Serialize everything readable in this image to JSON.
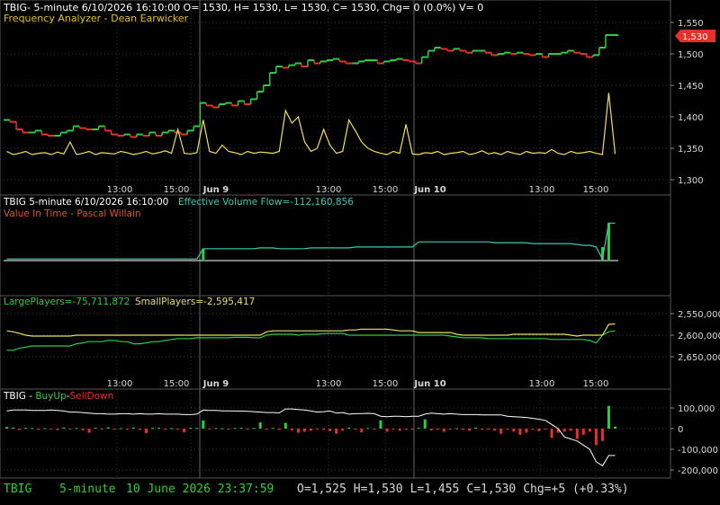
{
  "colors": {
    "background": "#000000",
    "grid": "#3a3a3a",
    "axis_text": "#d8d8d8",
    "up": "#2ecc40",
    "down": "#e8302a",
    "volume": "#f0e060",
    "evf": "#40c8b0",
    "vit": "#e05030",
    "large_players": "#2ecc40",
    "small_players": "#e8e060",
    "buy_sell_line": "#ffffff",
    "last_price_badge": "#e8302a",
    "footer_green": "#30d030"
  },
  "time_axis": {
    "labels": [
      "13:00",
      "15:00",
      "Jun 9",
      "13:00",
      "15:00",
      "Jun 10",
      "13:00",
      "15:00"
    ],
    "bold": [
      false,
      false,
      true,
      false,
      false,
      true,
      false,
      false
    ]
  },
  "panel1": {
    "header": "TBIG- 5-minute 6/10/2026 16:10:00 O= 1530, H= 1530, L= 1530, C= 1530, Chg= 0 (0.0%) V= 0",
    "subtitle": "Frequency Analyzer - Dean Earwicker",
    "y_ticks": [
      "1,550",
      "1,500",
      "1,450",
      "1,400",
      "1,350",
      "1,300"
    ],
    "last_price": "1,530"
  },
  "panel2": {
    "header_prefix": "TBIG 5-minute  6/10/2026 16:10:00",
    "header_evf": "Effective Volume Flow=-112,160,856",
    "subtitle": "Value In Time - Pascal Willain"
  },
  "panel3": {
    "label_large": "LargePlayers=-75,711,872",
    "label_small": "SmallPlayers=-2,595,417",
    "y_ticks": [
      "2,550,000",
      "2,600,000",
      "2,650,000"
    ]
  },
  "panel4": {
    "title_prefix": "TBIG - ",
    "title_buy": "BuyUp",
    "title_sep": "-",
    "title_sell": "SellDown",
    "y_ticks": [
      "100,000",
      "0",
      "-100,000",
      "-200,000"
    ]
  },
  "footer": {
    "symbol": "TBIG",
    "interval": "5-minute",
    "datetime": "10 June 2026 23:37:59",
    "open": "O=1,525",
    "high": "H=1,530",
    "low": "L=1,455",
    "close": "C=1,530",
    "change": "Chg=+5 (+0.33%)"
  },
  "chart_data": [
    {
      "type": "line",
      "title": "TBIG 5-minute price",
      "ylim": [
        1300,
        1560
      ],
      "series": [
        {
          "values": [
            1395,
            1392,
            1380,
            1375,
            1375,
            1378,
            1372,
            1370,
            1370,
            1375,
            1378,
            1385,
            1382,
            1380,
            1380,
            1385,
            1378,
            1372,
            1370,
            1372,
            1368,
            1372,
            1370,
            1375,
            1370,
            1375,
            1378,
            1375,
            1372,
            1378,
            1385,
            1422,
            1418,
            1415,
            1420,
            1422,
            1418,
            1425,
            1420,
            1428,
            1440,
            1450,
            1470,
            1480,
            1478,
            1482,
            1485,
            1480,
            1490,
            1485,
            1488,
            1490,
            1492,
            1488,
            1485,
            1485,
            1488,
            1490,
            1490,
            1485,
            1488,
            1490,
            1492,
            1490,
            1488,
            1485,
            1495,
            1505,
            1510,
            1508,
            1505,
            1508,
            1505,
            1502,
            1505,
            1505,
            1502,
            1498,
            1500,
            1502,
            1500,
            1502,
            1500,
            1498,
            1500,
            1495,
            1500,
            1500,
            1502,
            1505,
            1502,
            1500,
            1495,
            1498,
            1510,
            1530,
            1530
          ]
        }
      ]
    },
    {
      "type": "line",
      "title": "Frequency Analyzer - Dean Earwicker",
      "series": [
        {
          "values": [
            1345,
            1340,
            1342,
            1345,
            1340,
            1342,
            1343,
            1340,
            1344,
            1341,
            1360,
            1340,
            1342,
            1345,
            1340,
            1343,
            1342,
            1341,
            1345,
            1343,
            1340,
            1342,
            1345,
            1341,
            1343,
            1346,
            1342,
            1380,
            1342,
            1341,
            1343,
            1395,
            1345,
            1342,
            1355,
            1345,
            1343,
            1340,
            1345,
            1342,
            1344,
            1343,
            1342,
            1345,
            1410,
            1390,
            1400,
            1360,
            1345,
            1350,
            1380,
            1355,
            1342,
            1345,
            1395,
            1378,
            1360,
            1350,
            1345,
            1342,
            1340,
            1345,
            1342,
            1388,
            1341,
            1340,
            1343,
            1342,
            1345,
            1340,
            1342,
            1343,
            1345,
            1340,
            1342,
            1346,
            1341,
            1343,
            1340,
            1345,
            1342,
            1340,
            1345,
            1342,
            1343,
            1342,
            1348,
            1342,
            1340,
            1345,
            1342,
            1343,
            1345,
            1342,
            1340,
            1438,
            1341
          ]
        }
      ]
    },
    {
      "type": "line",
      "title": "Effective Volume Flow=-112,160,856",
      "series": [
        {
          "values": [
            2,
            2,
            2,
            2,
            2,
            2,
            2,
            2,
            2,
            2,
            2,
            2,
            2,
            2,
            2,
            2,
            2,
            2,
            2,
            2,
            2,
            2,
            2,
            2,
            2,
            2,
            2,
            2,
            2,
            2,
            2,
            8,
            8,
            8,
            8,
            8,
            8,
            8,
            8,
            8,
            8.5,
            8.5,
            8.5,
            8,
            8,
            8,
            8,
            8,
            8.5,
            8.5,
            8.5,
            8.5,
            8.5,
            8.5,
            8.5,
            9,
            9,
            9,
            9,
            9,
            9,
            9,
            9,
            9,
            9,
            12,
            12,
            12,
            12,
            12,
            12,
            12,
            12,
            12,
            12,
            12,
            12,
            11.5,
            11.5,
            11.5,
            11.5,
            11.5,
            11.5,
            11,
            11,
            11,
            11,
            11,
            11,
            11,
            10.5,
            10,
            10,
            9,
            2,
            23,
            23
          ]
        }
      ]
    },
    {
      "type": "line",
      "title": "LargePlayers / SmallPlayers",
      "series": [
        {
          "name": "LargePlayers",
          "values": [
            2635000,
            2635000,
            2630000,
            2628000,
            2625000,
            2625000,
            2625000,
            2625000,
            2625000,
            2625000,
            2625000,
            2620000,
            2618000,
            2615000,
            2615000,
            2615000,
            2612000,
            2612000,
            2615000,
            2615000,
            2620000,
            2620000,
            2618000,
            2615000,
            2615000,
            2612000,
            2610000,
            2608000,
            2608000,
            2608000,
            2606000,
            2606000,
            2606000,
            2606000,
            2606000,
            2606000,
            2605000,
            2605000,
            2605000,
            2606000,
            2606000,
            2600000,
            2598000,
            2598000,
            2598000,
            2598000,
            2600000,
            2598000,
            2598000,
            2598000,
            2596000,
            2596000,
            2596000,
            2596000,
            2600000,
            2600000,
            2600000,
            2600000,
            2600000,
            2600000,
            2600000,
            2600000,
            2600000,
            2600000,
            2600000,
            2600000,
            2600000,
            2600000,
            2600000,
            2600000,
            2602000,
            2604000,
            2606000,
            2606000,
            2606000,
            2606000,
            2608000,
            2608000,
            2608000,
            2608000,
            2608000,
            2608000,
            2608000,
            2608000,
            2608000,
            2608000,
            2610000,
            2610000,
            2610000,
            2610000,
            2610000,
            2610000,
            2612000,
            2618000,
            2600000,
            2592000,
            2590000
          ]
        },
        {
          "name": "SmallPlayers",
          "values": [
            2590000,
            2592000,
            2596000,
            2600000,
            2602000,
            2602000,
            2602000,
            2602000,
            2602000,
            2602000,
            2602000,
            2600000,
            2600000,
            2600000,
            2600000,
            2600000,
            2600000,
            2600000,
            2600000,
            2600000,
            2600000,
            2600000,
            2600000,
            2600000,
            2600000,
            2600000,
            2600000,
            2600000,
            2600000,
            2600000,
            2600000,
            2600000,
            2600000,
            2600000,
            2600000,
            2600000,
            2600000,
            2600000,
            2600000,
            2600000,
            2600000,
            2592000,
            2590000,
            2590000,
            2590000,
            2590000,
            2590000,
            2590000,
            2590000,
            2590000,
            2590000,
            2590000,
            2590000,
            2590000,
            2588000,
            2588000,
            2586000,
            2586000,
            2586000,
            2586000,
            2586000,
            2588000,
            2590000,
            2590000,
            2590000,
            2594000,
            2594000,
            2594000,
            2594000,
            2594000,
            2594000,
            2598000,
            2600000,
            2600000,
            2600000,
            2600000,
            2600000,
            2600000,
            2600000,
            2600000,
            2598000,
            2598000,
            2598000,
            2598000,
            2598000,
            2598000,
            2598000,
            2598000,
            2598000,
            2600000,
            2602000,
            2600000,
            2600000,
            2600000,
            2600000,
            2575000,
            2574000
          ]
        }
      ]
    },
    {
      "type": "bar",
      "title": "BuyUp-SellDown",
      "ylim": [
        -220000,
        120000
      ],
      "series": [
        {
          "values": [
            8000,
            5000,
            -6000,
            4000,
            3000,
            -5000,
            2000,
            -3000,
            -7000,
            5000,
            -4000,
            3000,
            -8000,
            -20000,
            4000,
            -3000,
            6000,
            -4000,
            2000,
            -3000,
            5000,
            -6000,
            -22000,
            3000,
            4000,
            -4000,
            2000,
            -2000,
            -18000,
            4000,
            3000,
            40000,
            -3000,
            3000,
            2000,
            -2000,
            3000,
            4000,
            -2000,
            3000,
            30000,
            -2000,
            3000,
            -6000,
            28000,
            -8000,
            -20000,
            -15000,
            -10000,
            -4000,
            -5000,
            -12000,
            -25000,
            -10000,
            5000,
            -4000,
            -18000,
            3000,
            -4000,
            40000,
            -15000,
            -3000,
            -10000,
            -5000,
            -3000,
            4000,
            45000,
            -8000,
            -5000,
            -15000,
            -3000,
            2000,
            -5000,
            -10000,
            5000,
            -5000,
            -3000,
            -10000,
            -25000,
            -5000,
            -15000,
            -30000,
            -20000,
            -3000,
            -12000,
            -5000,
            -45000,
            -20000,
            -15000,
            -10000,
            -50000,
            -30000,
            -15000,
            -80000,
            -60000,
            110000,
            10000
          ]
        },
        {
          "name": "line",
          "values": [
            85000,
            90000,
            90000,
            90000,
            88000,
            88000,
            88000,
            90000,
            88000,
            85000,
            80000,
            80000,
            78000,
            75000,
            72000,
            72000,
            70000,
            70000,
            72000,
            72000,
            70000,
            72000,
            70000,
            70000,
            72000,
            70000,
            70000,
            70000,
            68000,
            68000,
            70000,
            90000,
            88000,
            88000,
            86000,
            86000,
            85000,
            85000,
            84000,
            82000,
            80000,
            78000,
            78000,
            76000,
            95000,
            95000,
            92000,
            90000,
            85000,
            80000,
            82000,
            85000,
            75000,
            78000,
            70000,
            72000,
            73000,
            74000,
            72000,
            60000,
            58000,
            60000,
            60000,
            58000,
            60000,
            60000,
            70000,
            75000,
            72000,
            70000,
            72000,
            70000,
            68000,
            68000,
            68000,
            66000,
            66000,
            66000,
            66000,
            60000,
            58000,
            56000,
            54000,
            50000,
            45000,
            40000,
            20000,
            0,
            -40000,
            -50000,
            -60000,
            -80000,
            -100000,
            -160000,
            -180000,
            -130000,
            -130000
          ]
        }
      ]
    }
  ]
}
